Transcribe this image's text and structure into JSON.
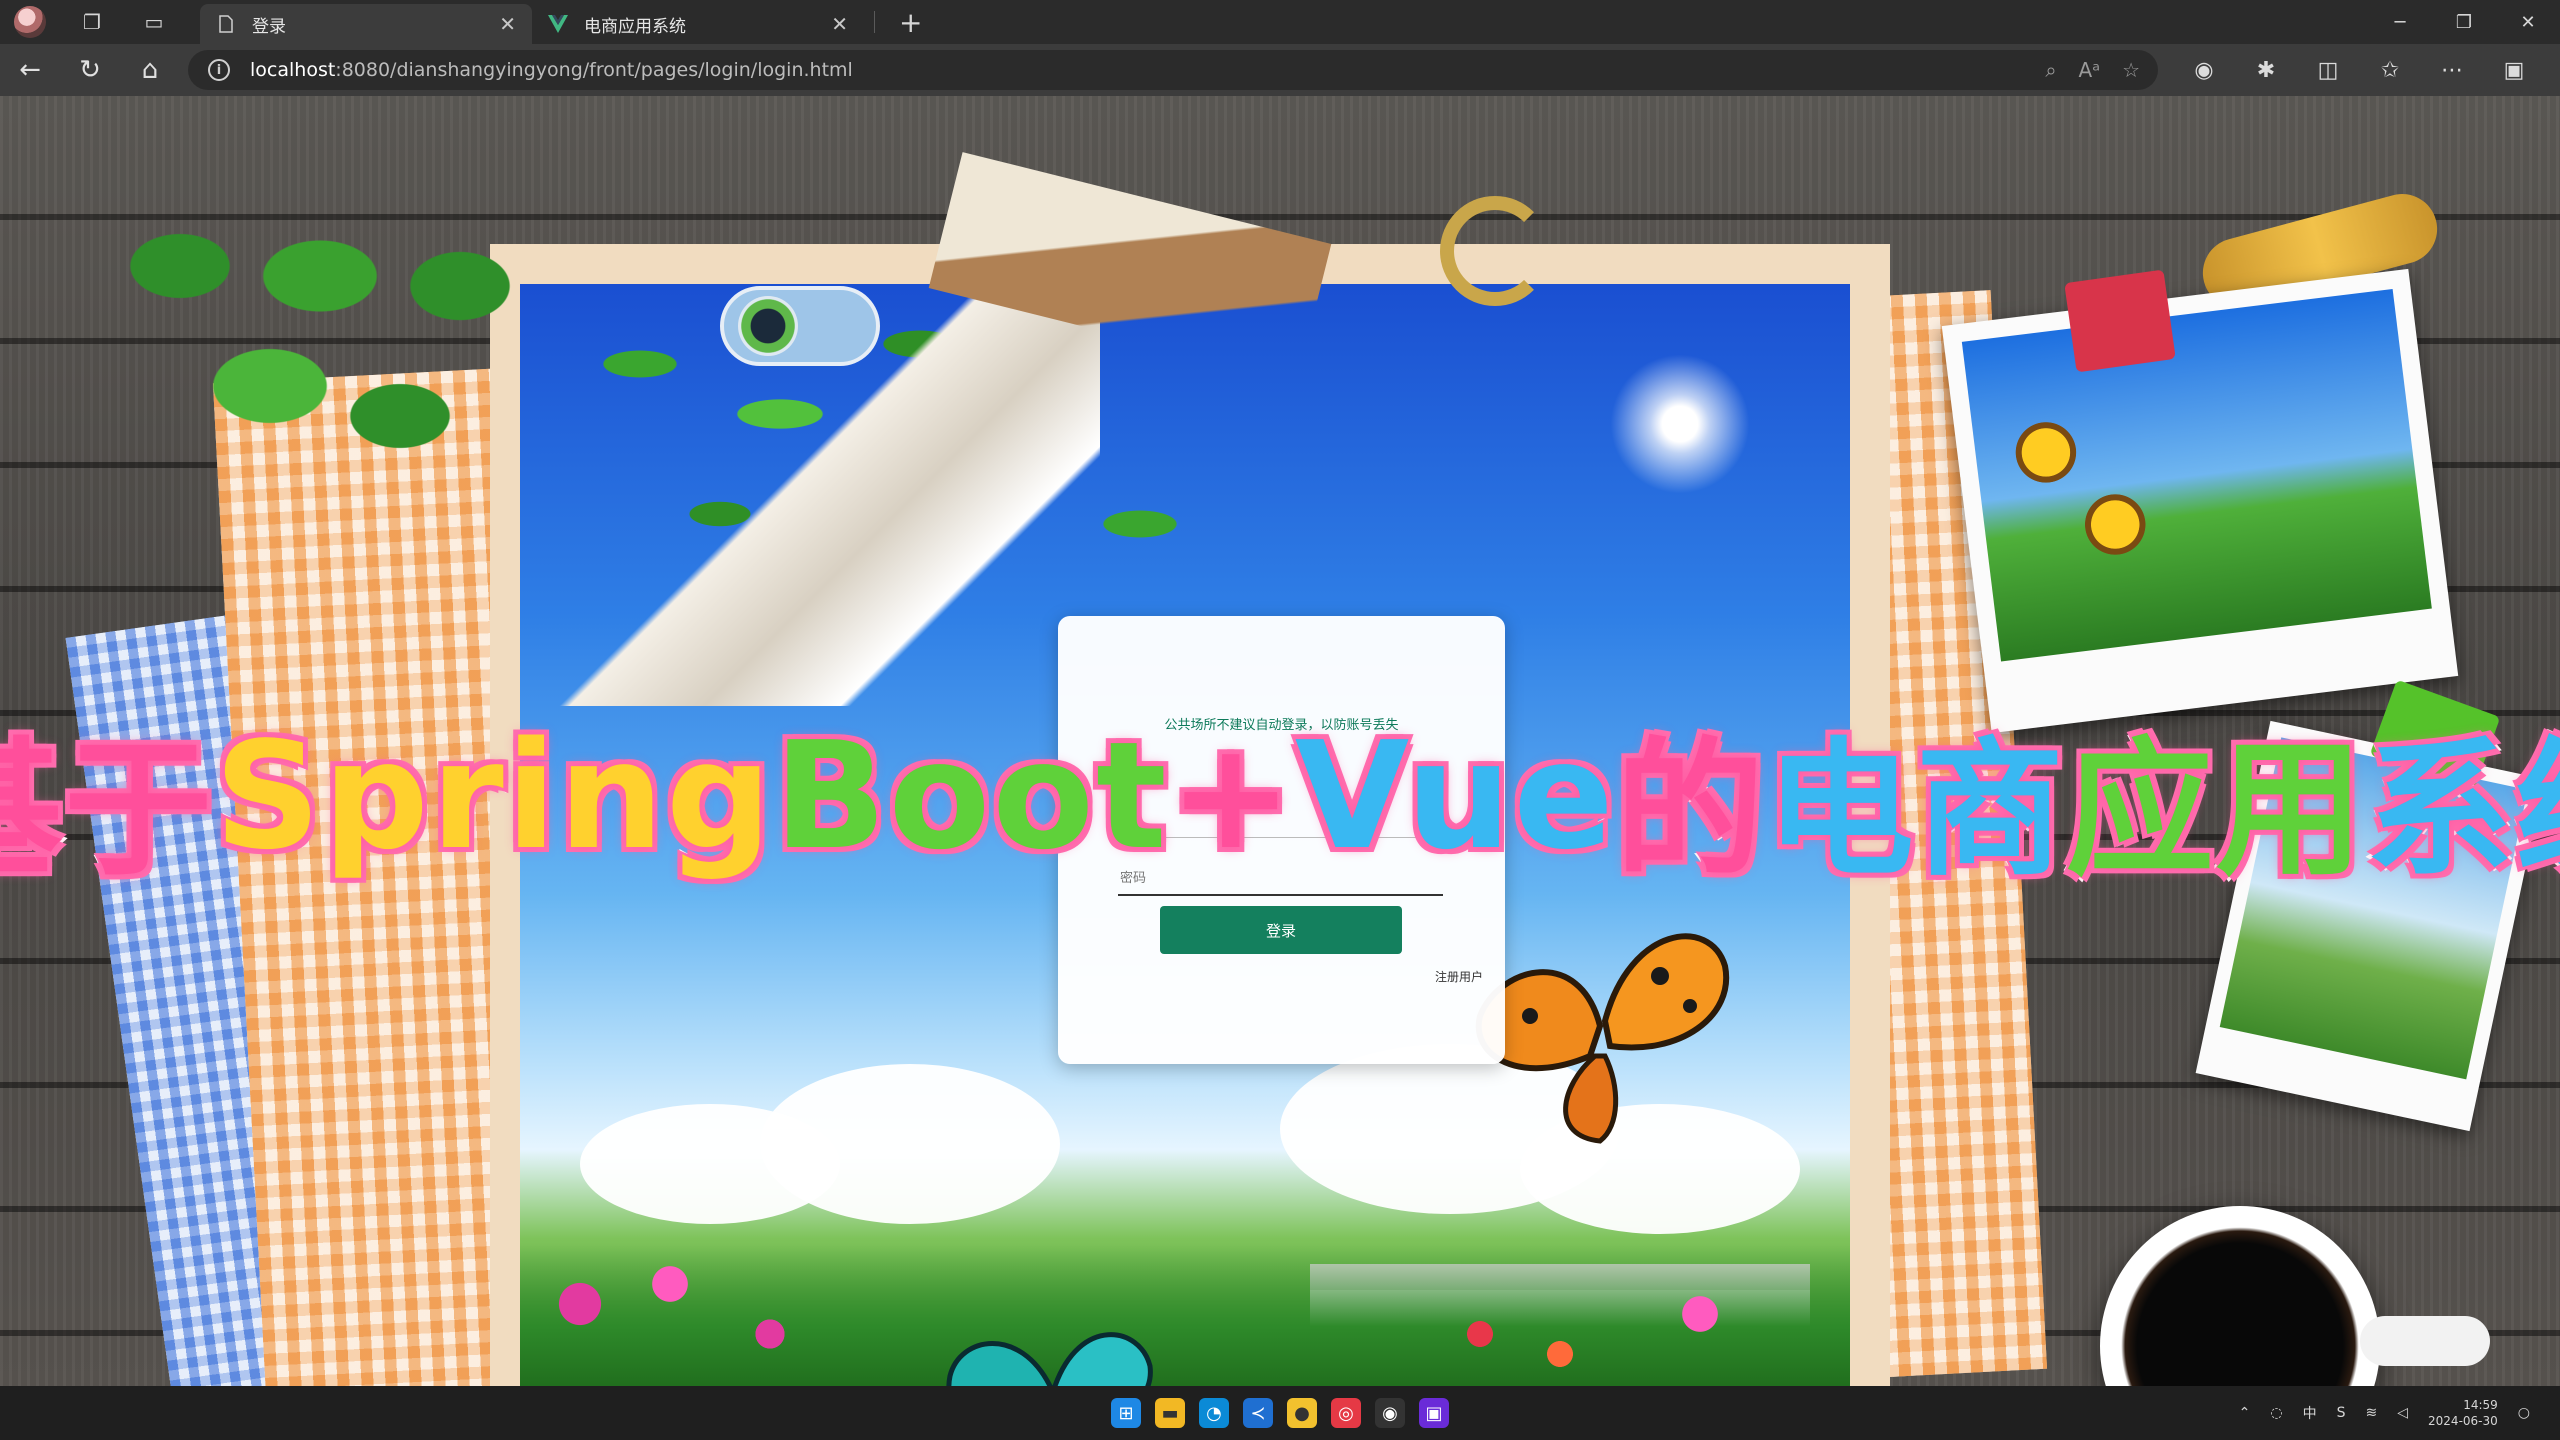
{
  "browser": {
    "tabs": [
      {
        "title": "登录",
        "active": true,
        "icon": "page-icon"
      },
      {
        "title": "电商应用系统",
        "active": false,
        "icon": "vue-logo-icon"
      }
    ],
    "url": {
      "host": "localhost",
      "path": ":8080/dianshangyingyong/front/pages/login/login.html"
    }
  },
  "login": {
    "tip": "公共场所不建议自动登录，以防账号丢失",
    "password_placeholder": "密码",
    "button_label": "登录",
    "register_label": "注册用户"
  },
  "overlay": {
    "parts": [
      {
        "text": "基于",
        "color": "#ff4f9b"
      },
      {
        "text": "Spring",
        "color": "#ffd12e"
      },
      {
        "text": "Boot",
        "color": "#5fd13a"
      },
      {
        "text": "+",
        "color": "#ff4f9b"
      },
      {
        "text": "Vue",
        "color": "#39b8f2"
      },
      {
        "text": "的",
        "color": "#ff4f9b"
      },
      {
        "text": "电商",
        "color": "#39b8f2"
      },
      {
        "text": "应用",
        "color": "#5fd13a"
      },
      {
        "text": "系统",
        "color": "#39b8f2"
      }
    ]
  },
  "taskbar": {
    "time": "14:59",
    "date": "2024-06-30"
  },
  "colors": {
    "accent": "#14805e",
    "tip_text": "#0d7a5a"
  }
}
